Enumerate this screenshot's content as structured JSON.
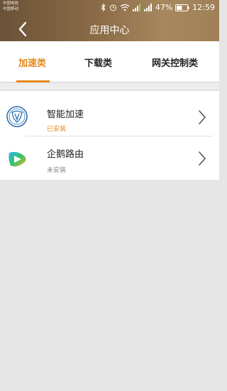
{
  "status_bar": {
    "carrier1": "中国电信",
    "carrier2": "中国移动",
    "battery": "47%",
    "time": "12:59"
  },
  "header": {
    "title": "应用中心",
    "back_icon": "chevron-left-icon"
  },
  "tabs": [
    {
      "label": "加速类",
      "active": true
    },
    {
      "label": "下载类",
      "active": false
    },
    {
      "label": "网关控制类",
      "active": false
    }
  ],
  "apps": [
    {
      "name": "智能加速",
      "status": "已安装",
      "status_color": "#e8891a",
      "icon": "speed-shield-icon"
    },
    {
      "name": "企鹅路由",
      "status": "未安装",
      "status_color": "#888888",
      "icon": "penguin-router-icon"
    }
  ],
  "colors": {
    "accent": "#e8891a",
    "header_from": "#6b5238",
    "header_to": "#a7885e"
  }
}
